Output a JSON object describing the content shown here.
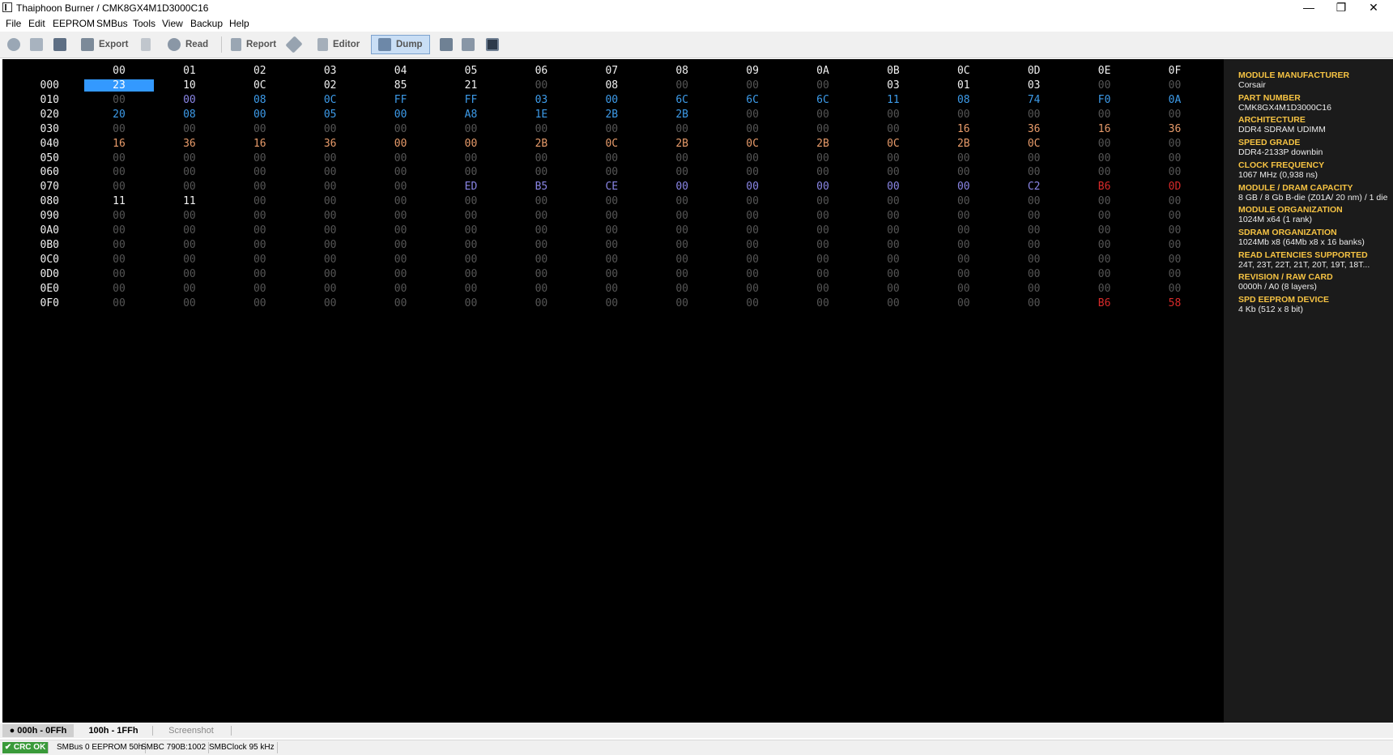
{
  "window": {
    "title": "Thaiphoon Burner / CMK8GX4M1D3000C16",
    "minimize": "—",
    "maximize": "❐",
    "close": "✕"
  },
  "menu": [
    "File",
    "Edit",
    "EEPROM",
    "SMBus",
    "Tools",
    "View",
    "Backup",
    "Help"
  ],
  "toolbar": {
    "export_label": "Export",
    "read_label": "Read",
    "report_label": "Report",
    "editor_label": "Editor",
    "dump_label": "Dump"
  },
  "hex": {
    "columns": [
      "00",
      "01",
      "02",
      "03",
      "04",
      "05",
      "06",
      "07",
      "08",
      "09",
      "0A",
      "0B",
      "0C",
      "0D",
      "0E",
      "0F"
    ],
    "rows": [
      {
        "addr": "000",
        "cells": [
          "23",
          "10",
          "0C",
          "02",
          "85",
          "21",
          "00",
          "08",
          "00",
          "00",
          "00",
          "03",
          "01",
          "03",
          "00",
          "00"
        ]
      },
      {
        "addr": "010",
        "cells": [
          "00",
          "00",
          "08",
          "0C",
          "FF",
          "FF",
          "03",
          "00",
          "6C",
          "6C",
          "6C",
          "11",
          "08",
          "74",
          "F0",
          "0A"
        ]
      },
      {
        "addr": "020",
        "cells": [
          "20",
          "08",
          "00",
          "05",
          "00",
          "A8",
          "1E",
          "2B",
          "2B",
          "00",
          "00",
          "00",
          "00",
          "00",
          "00",
          "00"
        ]
      },
      {
        "addr": "030",
        "cells": [
          "00",
          "00",
          "00",
          "00",
          "00",
          "00",
          "00",
          "00",
          "00",
          "00",
          "00",
          "00",
          "16",
          "36",
          "16",
          "36"
        ]
      },
      {
        "addr": "040",
        "cells": [
          "16",
          "36",
          "16",
          "36",
          "00",
          "00",
          "2B",
          "0C",
          "2B",
          "0C",
          "2B",
          "0C",
          "2B",
          "0C",
          "00",
          "00"
        ]
      },
      {
        "addr": "050",
        "cells": [
          "00",
          "00",
          "00",
          "00",
          "00",
          "00",
          "00",
          "00",
          "00",
          "00",
          "00",
          "00",
          "00",
          "00",
          "00",
          "00"
        ]
      },
      {
        "addr": "060",
        "cells": [
          "00",
          "00",
          "00",
          "00",
          "00",
          "00",
          "00",
          "00",
          "00",
          "00",
          "00",
          "00",
          "00",
          "00",
          "00",
          "00"
        ]
      },
      {
        "addr": "070",
        "cells": [
          "00",
          "00",
          "00",
          "00",
          "00",
          "ED",
          "B5",
          "CE",
          "00",
          "00",
          "00",
          "00",
          "00",
          "C2",
          "B6",
          "0D"
        ]
      },
      {
        "addr": "080",
        "cells": [
          "11",
          "11",
          "00",
          "00",
          "00",
          "00",
          "00",
          "00",
          "00",
          "00",
          "00",
          "00",
          "00",
          "00",
          "00",
          "00"
        ]
      },
      {
        "addr": "090",
        "cells": [
          "00",
          "00",
          "00",
          "00",
          "00",
          "00",
          "00",
          "00",
          "00",
          "00",
          "00",
          "00",
          "00",
          "00",
          "00",
          "00"
        ]
      },
      {
        "addr": "0A0",
        "cells": [
          "00",
          "00",
          "00",
          "00",
          "00",
          "00",
          "00",
          "00",
          "00",
          "00",
          "00",
          "00",
          "00",
          "00",
          "00",
          "00"
        ]
      },
      {
        "addr": "0B0",
        "cells": [
          "00",
          "00",
          "00",
          "00",
          "00",
          "00",
          "00",
          "00",
          "00",
          "00",
          "00",
          "00",
          "00",
          "00",
          "00",
          "00"
        ]
      },
      {
        "addr": "0C0",
        "cells": [
          "00",
          "00",
          "00",
          "00",
          "00",
          "00",
          "00",
          "00",
          "00",
          "00",
          "00",
          "00",
          "00",
          "00",
          "00",
          "00"
        ]
      },
      {
        "addr": "0D0",
        "cells": [
          "00",
          "00",
          "00",
          "00",
          "00",
          "00",
          "00",
          "00",
          "00",
          "00",
          "00",
          "00",
          "00",
          "00",
          "00",
          "00"
        ]
      },
      {
        "addr": "0E0",
        "cells": [
          "00",
          "00",
          "00",
          "00",
          "00",
          "00",
          "00",
          "00",
          "00",
          "00",
          "00",
          "00",
          "00",
          "00",
          "00",
          "00"
        ]
      },
      {
        "addr": "0F0",
        "cells": [
          "00",
          "00",
          "00",
          "00",
          "00",
          "00",
          "00",
          "00",
          "00",
          "00",
          "00",
          "00",
          "00",
          "00",
          "B6",
          "58"
        ]
      }
    ],
    "colors": {
      "default": "#f0f0f0",
      "zero": "#555555",
      "blue": "#3d9be9",
      "lavender": "#8a86e6",
      "orange": "#e89b6a",
      "red": "#d82a2a",
      "selected": "#3399ff"
    },
    "cell_colors": {
      "010": [
        "zero",
        "lavender",
        "blue",
        "blue",
        "blue",
        "blue",
        "blue",
        "blue",
        "blue",
        "blue",
        "blue",
        "blue",
        "blue",
        "blue",
        "blue",
        "blue"
      ],
      "020": [
        "blue",
        "blue",
        "blue",
        "blue",
        "blue",
        "blue",
        "blue",
        "blue",
        "blue",
        "zero",
        "zero",
        "zero",
        "zero",
        "zero",
        "zero",
        "zero"
      ],
      "030": [
        "zero",
        "zero",
        "zero",
        "zero",
        "zero",
        "zero",
        "zero",
        "zero",
        "zero",
        "zero",
        "zero",
        "zero",
        "orange",
        "orange",
        "orange",
        "orange"
      ],
      "040": [
        "orange",
        "orange",
        "orange",
        "orange",
        "orange",
        "orange",
        "orange",
        "orange",
        "orange",
        "orange",
        "orange",
        "orange",
        "orange",
        "orange",
        "zero",
        "zero"
      ],
      "070": [
        "zero",
        "zero",
        "zero",
        "zero",
        "zero",
        "lavender",
        "lavender",
        "lavender",
        "lavender",
        "lavender",
        "lavender",
        "lavender",
        "lavender",
        "lavender",
        "red",
        "red"
      ],
      "0F0": [
        "zero",
        "zero",
        "zero",
        "zero",
        "zero",
        "zero",
        "zero",
        "zero",
        "zero",
        "zero",
        "zero",
        "zero",
        "zero",
        "zero",
        "red",
        "red"
      ]
    },
    "selected_cell": {
      "row": "000",
      "col": "00"
    }
  },
  "info": [
    {
      "label": "MODULE MANUFACTURER",
      "value": "Corsair"
    },
    {
      "label": "PART NUMBER",
      "value": "CMK8GX4M1D3000C16"
    },
    {
      "label": "ARCHITECTURE",
      "value": "DDR4 SDRAM UDIMM"
    },
    {
      "label": "SPEED GRADE",
      "value": "DDR4-2133P downbin"
    },
    {
      "label": "CLOCK FREQUENCY",
      "value": "1067 MHz (0,938 ns)"
    },
    {
      "label": "MODULE / DRAM CAPACITY",
      "value": "8 GB / 8 Gb B-die (Z01A/ 20 nm) / 1 die"
    },
    {
      "label": "MODULE ORGANIZATION",
      "value": "1024M x64 (1 rank)"
    },
    {
      "label": "SDRAM ORGANIZATION",
      "value": "1024Mb x8 (64Mb x8 x 16 banks)"
    },
    {
      "label": "READ LATENCIES SUPPORTED",
      "value": "24T, 23T, 22T, 21T, 20T, 19T, 18T..."
    },
    {
      "label": "REVISION / RAW CARD",
      "value": "0000h / A0 (8 layers)"
    },
    {
      "label": "SPD EEPROM DEVICE",
      "value": "4 Kb (512 x 8 bit)"
    }
  ],
  "tabs": [
    "000h - 0FFh",
    "100h - 1FFh",
    "Screenshot"
  ],
  "status": {
    "crc": "✔ CRC OK",
    "smbus": "SMBus 0 EEPROM 50h",
    "smbc": "SMBC 790B:1002",
    "clock": "SMBClock 95 kHz"
  }
}
